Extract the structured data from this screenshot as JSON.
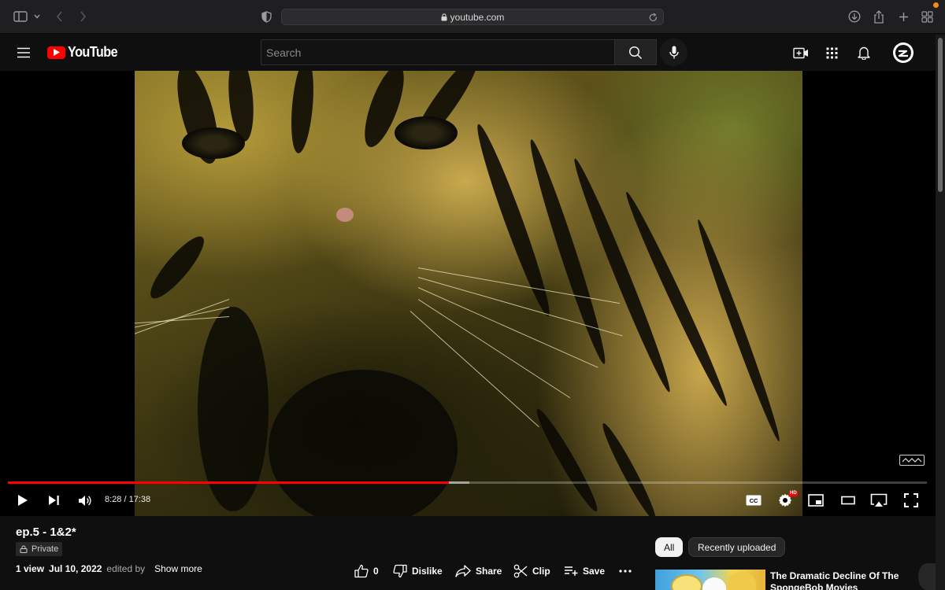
{
  "browser": {
    "url": "youtube.com"
  },
  "masthead": {
    "logo_text": "YouTube",
    "search_placeholder": "Search"
  },
  "player": {
    "current_time": "8:28",
    "duration": "17:38",
    "time_display": "8:28 / 17:38",
    "progress_fraction": 0.48,
    "buffer_fraction": 0.502,
    "hd_badge": "HD",
    "cc_label": "CC"
  },
  "video": {
    "title": "ep.5 - 1&2*",
    "privacy": "Private",
    "views": "1 view",
    "date": "Jul 10, 2022",
    "edited_by": "edited by",
    "show_more": "Show more"
  },
  "actions": {
    "likes": "0",
    "dislike": "Dislike",
    "share": "Share",
    "clip": "Clip",
    "save": "Save"
  },
  "chips": {
    "all": "All",
    "recently_uploaded": "Recently uploaded"
  },
  "recommendation": {
    "title": "The Dramatic Decline Of The SpongeBob Movies"
  },
  "colors": {
    "yt_red": "#ff0000",
    "background": "#0f0f0f",
    "safari_toolbar": "#1f1f21"
  }
}
